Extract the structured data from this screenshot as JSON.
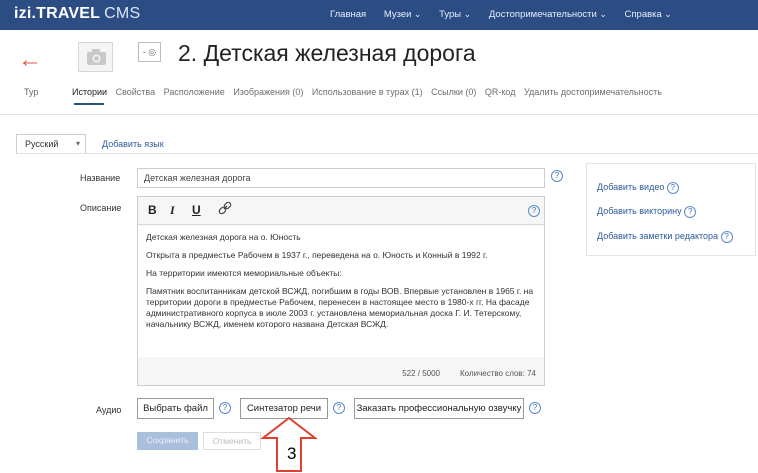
{
  "header": {
    "logo": "izi.TRAVEL",
    "cms": "CMS",
    "nav": [
      {
        "label": "Главная",
        "dd": false
      },
      {
        "label": "Музеи",
        "dd": true
      },
      {
        "label": "Туры",
        "dd": true
      },
      {
        "label": "Достопримечательности",
        "dd": true
      },
      {
        "label": "Справка",
        "dd": true
      }
    ]
  },
  "page": {
    "title": "2. Детская железная дорога",
    "type_label": "Тур",
    "lang_toggle": "- ◎"
  },
  "tabs": [
    "Истории",
    "Свойства",
    "Расположение",
    "Изображения (0)",
    "Использование в турах (1)",
    "Ссылки (0)",
    "QR-код",
    "Удалить достопримечательность"
  ],
  "language": {
    "selected": "Русский",
    "add": "Добавить язык"
  },
  "form": {
    "name_label": "Название",
    "name_value": "Детская железная дорога",
    "desc_label": "Описание",
    "desc_paragraphs": [
      "Детская железная дорога на о. Юность",
      "Открыта в предместье Рабочем в 1937 г., переведена на о. Юность и Конный в 1992 г.",
      "На территории имеются мемориальные объекты:",
      "Памятник воспитанникам детской ВСЖД, погибшим в годы ВОВ. Впервые установлен в 1965 г. на территории дороги в предместье Рабочем, перенесен в настоящее место в 1980-х гг. На фасаде административного корпуса в июле 2003 г. установлена мемориальная доска Г. И. Тетерскому, начальнику ВСЖД, именем которого названа Детская ВСЖД."
    ],
    "char_count": "522 / 5000",
    "word_count": "Количество слов: 74",
    "audio_label": "Аудио",
    "audio_buttons": [
      "Выбрать файл",
      "Синтезатор речи",
      "Заказать профессиональную озвучку"
    ],
    "save": "Сохранить",
    "cancel": "Отменить"
  },
  "sidebar": {
    "links": [
      "Добавить видео",
      "Добавить викторину",
      "Добавить заметки редактора"
    ]
  },
  "editor_tools": [
    "B",
    "I",
    "U",
    "link"
  ],
  "help_symbol": "?",
  "annotation": {
    "number": "3"
  },
  "colors": {
    "topbar": "#2c4c84",
    "link": "#2d5a9a",
    "accent_arrow": "#e25547",
    "disabled_button": "#a9bfdc"
  }
}
